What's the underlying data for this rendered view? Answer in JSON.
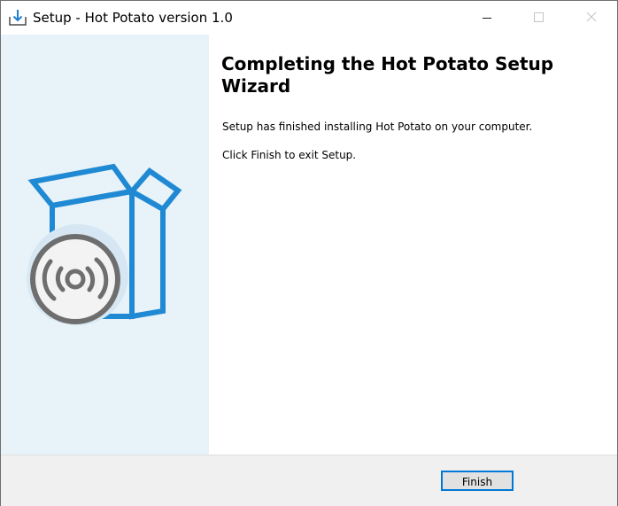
{
  "window": {
    "title": "Setup - Hot Potato version 1.0"
  },
  "icons": {
    "app": "download-icon",
    "minimize": "minimize-icon",
    "maximize": "maximize-icon",
    "close": "close-icon",
    "illustration": "box-with-disc-icon"
  },
  "wizard": {
    "heading": "Completing the Hot Potato Setup Wizard",
    "message": "Setup has finished installing Hot Potato on your computer.",
    "instruction": "Click Finish to exit Setup."
  },
  "footer": {
    "finish_label": "Finish"
  },
  "colors": {
    "side_panel": "#e8f2f9",
    "box_blue": "#1f89d3",
    "disc_gray": "#6e6e6e",
    "accent": "#0078d7",
    "footer_bg": "#f0f0f0"
  }
}
